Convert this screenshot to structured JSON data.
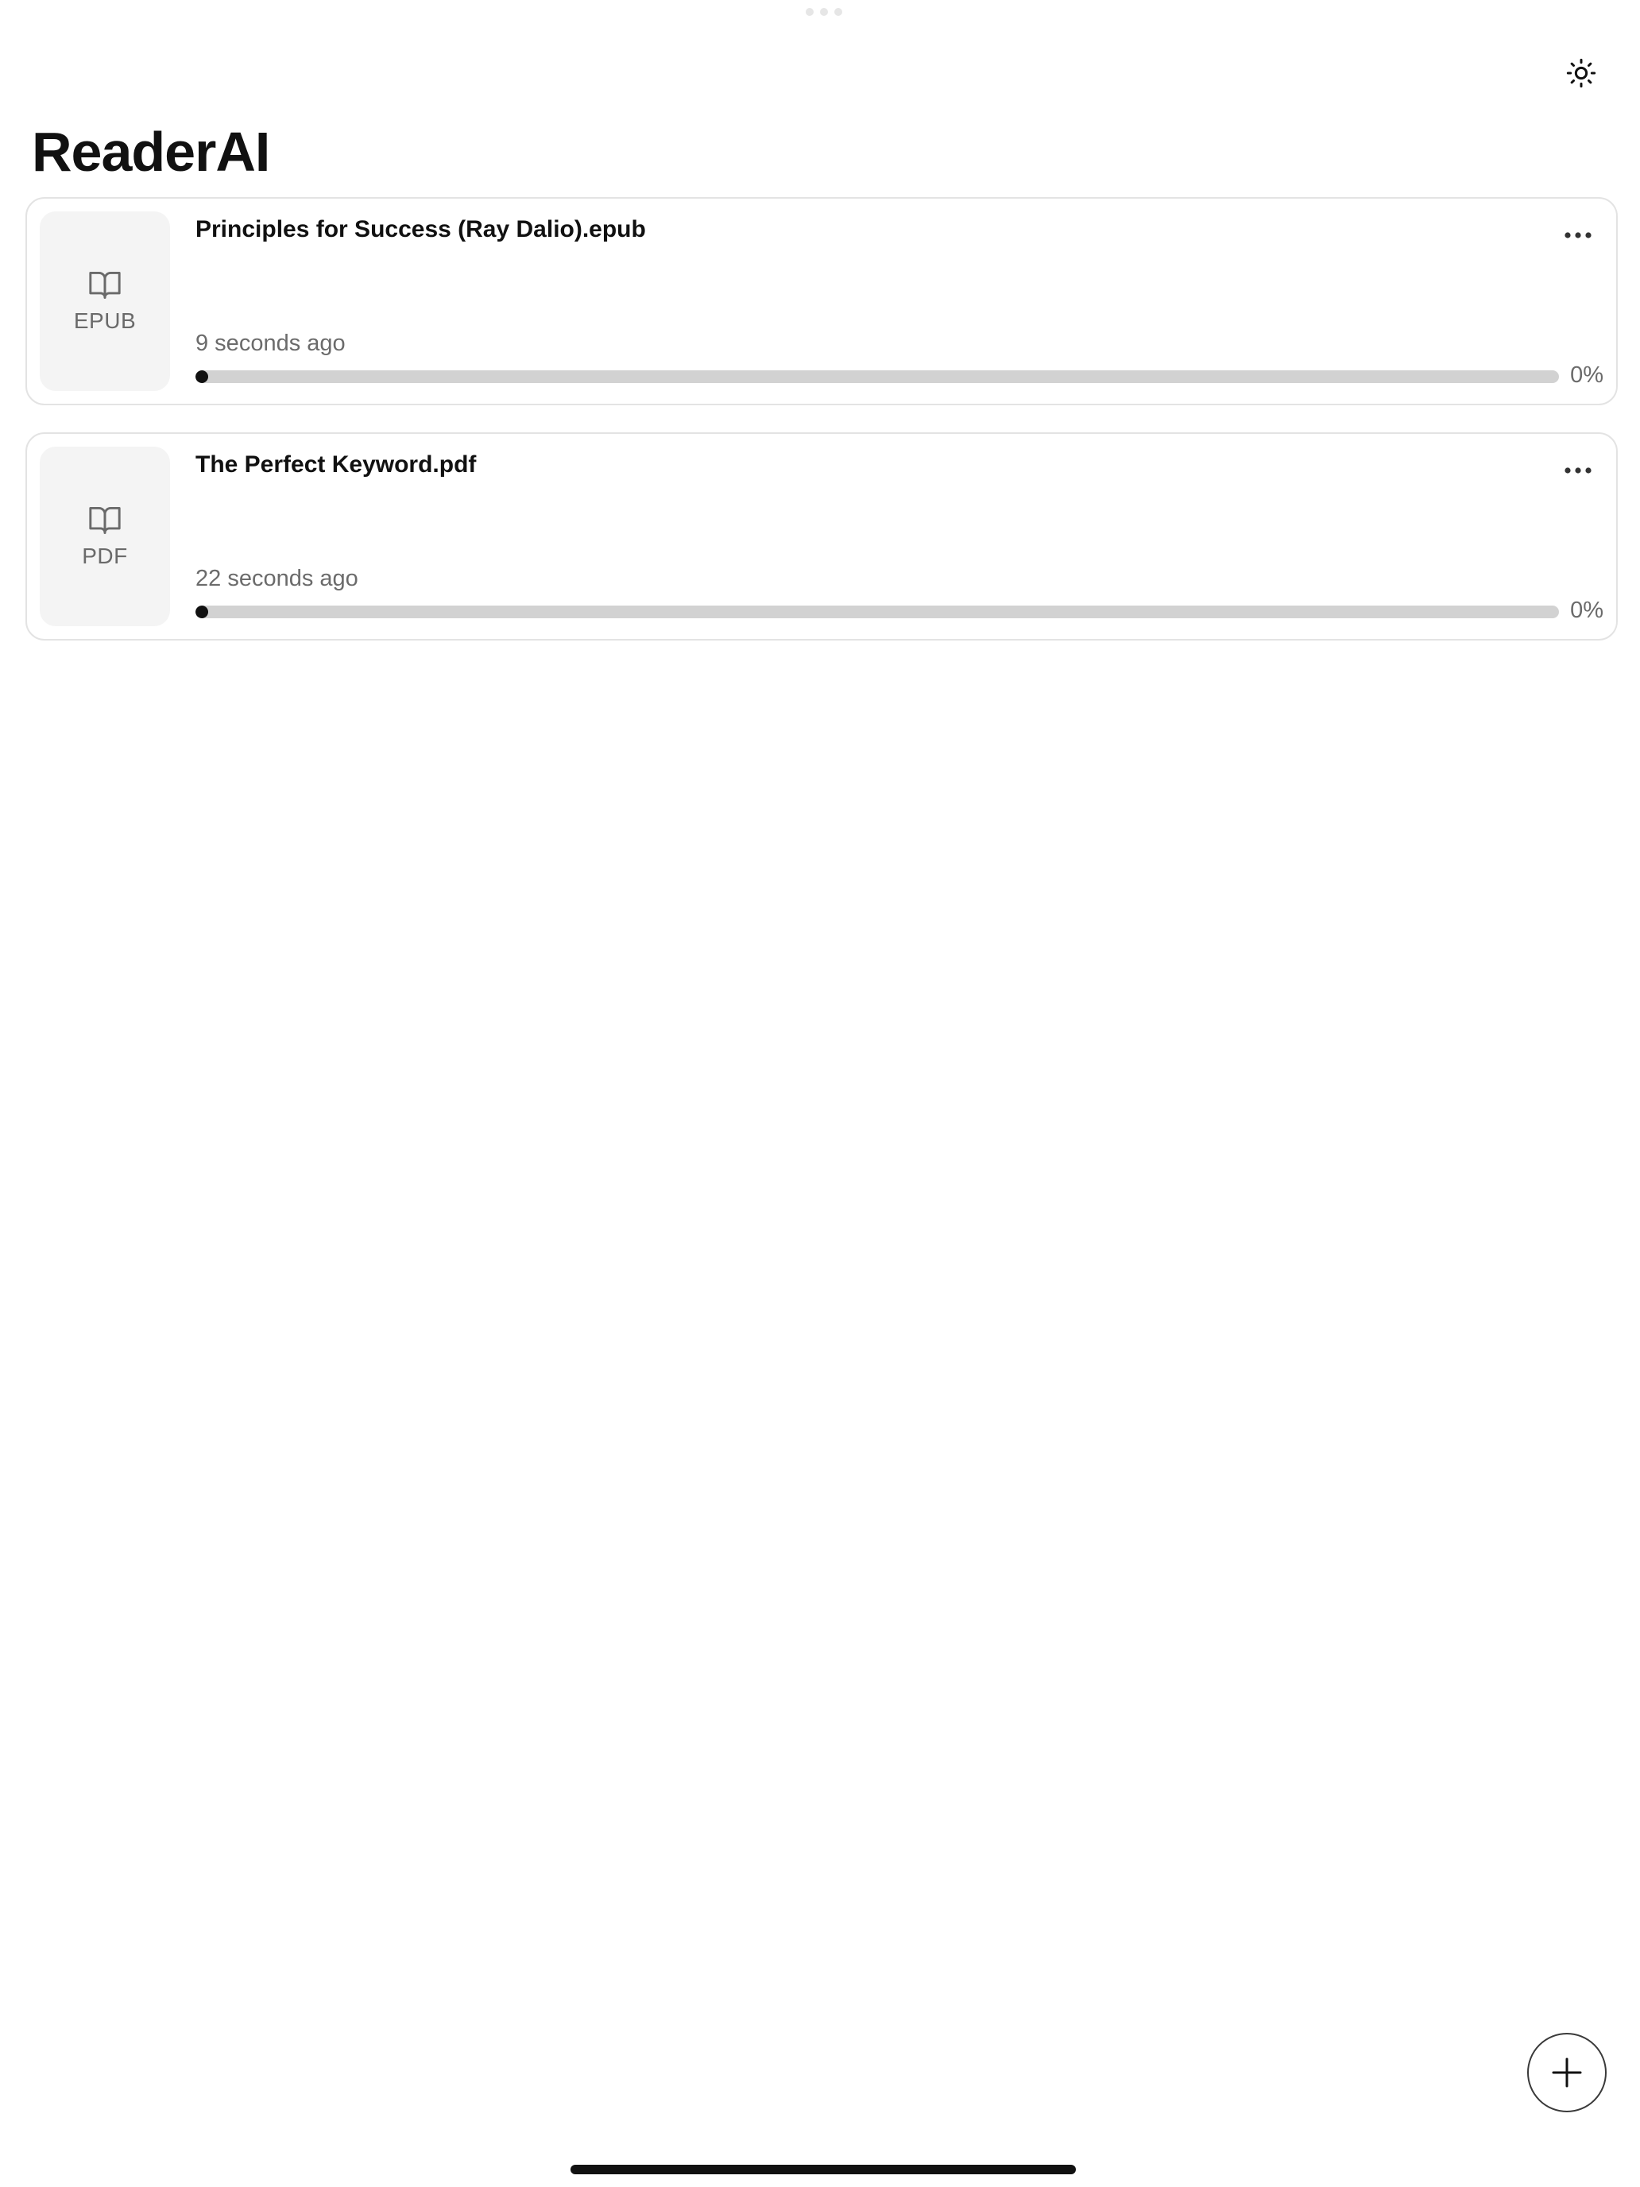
{
  "app": {
    "title": "ReaderAI"
  },
  "header": {
    "theme_toggle_icon": "sun-icon"
  },
  "books": [
    {
      "title": "Principles for Success (Ray Dalio).epub",
      "type": "EPUB",
      "icon": "book-open-icon",
      "last_opened": "9 seconds ago",
      "progress": 0,
      "progress_label": "0%",
      "menu_icon": "ellipsis-icon"
    },
    {
      "title": "The Perfect Keyword.pdf",
      "type": "PDF",
      "icon": "book-open-icon",
      "last_opened": "22 seconds ago",
      "progress": 0,
      "progress_label": "0%",
      "menu_icon": "ellipsis-icon"
    }
  ],
  "fab": {
    "icon": "plus-icon"
  },
  "colors": {
    "text": "#111111",
    "muted": "#6b6b6b",
    "card_border": "#e3e3e3",
    "thumb_bg": "#f4f4f4",
    "progress_track": "#d2d2d2",
    "progress_fill": "#111111"
  }
}
